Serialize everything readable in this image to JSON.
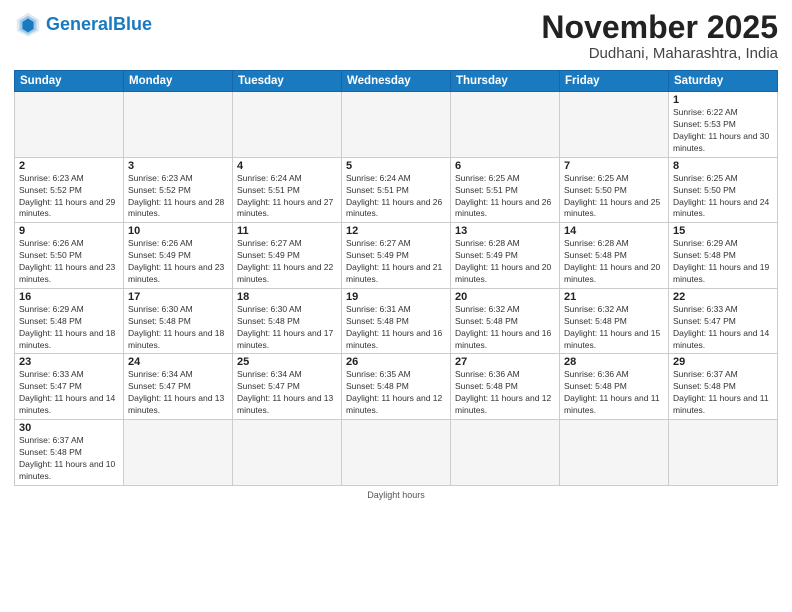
{
  "header": {
    "logo_general": "General",
    "logo_blue": "Blue",
    "month_title": "November 2025",
    "location": "Dudhani, Maharashtra, India"
  },
  "weekdays": [
    "Sunday",
    "Monday",
    "Tuesday",
    "Wednesday",
    "Thursday",
    "Friday",
    "Saturday"
  ],
  "footer": {
    "daylight_label": "Daylight hours"
  },
  "weeks": [
    [
      {
        "day": "",
        "sunrise": "",
        "sunset": "",
        "daylight": "",
        "empty": true
      },
      {
        "day": "",
        "sunrise": "",
        "sunset": "",
        "daylight": "",
        "empty": true
      },
      {
        "day": "",
        "sunrise": "",
        "sunset": "",
        "daylight": "",
        "empty": true
      },
      {
        "day": "",
        "sunrise": "",
        "sunset": "",
        "daylight": "",
        "empty": true
      },
      {
        "day": "",
        "sunrise": "",
        "sunset": "",
        "daylight": "",
        "empty": true
      },
      {
        "day": "",
        "sunrise": "",
        "sunset": "",
        "daylight": "",
        "empty": true
      },
      {
        "day": "1",
        "sunrise": "Sunrise: 6:22 AM",
        "sunset": "Sunset: 5:53 PM",
        "daylight": "Daylight: 11 hours and 30 minutes.",
        "empty": false
      }
    ],
    [
      {
        "day": "2",
        "sunrise": "Sunrise: 6:23 AM",
        "sunset": "Sunset: 5:52 PM",
        "daylight": "Daylight: 11 hours and 29 minutes.",
        "empty": false
      },
      {
        "day": "3",
        "sunrise": "Sunrise: 6:23 AM",
        "sunset": "Sunset: 5:52 PM",
        "daylight": "Daylight: 11 hours and 28 minutes.",
        "empty": false
      },
      {
        "day": "4",
        "sunrise": "Sunrise: 6:24 AM",
        "sunset": "Sunset: 5:51 PM",
        "daylight": "Daylight: 11 hours and 27 minutes.",
        "empty": false
      },
      {
        "day": "5",
        "sunrise": "Sunrise: 6:24 AM",
        "sunset": "Sunset: 5:51 PM",
        "daylight": "Daylight: 11 hours and 26 minutes.",
        "empty": false
      },
      {
        "day": "6",
        "sunrise": "Sunrise: 6:25 AM",
        "sunset": "Sunset: 5:51 PM",
        "daylight": "Daylight: 11 hours and 26 minutes.",
        "empty": false
      },
      {
        "day": "7",
        "sunrise": "Sunrise: 6:25 AM",
        "sunset": "Sunset: 5:50 PM",
        "daylight": "Daylight: 11 hours and 25 minutes.",
        "empty": false
      },
      {
        "day": "8",
        "sunrise": "Sunrise: 6:25 AM",
        "sunset": "Sunset: 5:50 PM",
        "daylight": "Daylight: 11 hours and 24 minutes.",
        "empty": false
      }
    ],
    [
      {
        "day": "9",
        "sunrise": "Sunrise: 6:26 AM",
        "sunset": "Sunset: 5:50 PM",
        "daylight": "Daylight: 11 hours and 23 minutes.",
        "empty": false
      },
      {
        "day": "10",
        "sunrise": "Sunrise: 6:26 AM",
        "sunset": "Sunset: 5:49 PM",
        "daylight": "Daylight: 11 hours and 23 minutes.",
        "empty": false
      },
      {
        "day": "11",
        "sunrise": "Sunrise: 6:27 AM",
        "sunset": "Sunset: 5:49 PM",
        "daylight": "Daylight: 11 hours and 22 minutes.",
        "empty": false
      },
      {
        "day": "12",
        "sunrise": "Sunrise: 6:27 AM",
        "sunset": "Sunset: 5:49 PM",
        "daylight": "Daylight: 11 hours and 21 minutes.",
        "empty": false
      },
      {
        "day": "13",
        "sunrise": "Sunrise: 6:28 AM",
        "sunset": "Sunset: 5:49 PM",
        "daylight": "Daylight: 11 hours and 20 minutes.",
        "empty": false
      },
      {
        "day": "14",
        "sunrise": "Sunrise: 6:28 AM",
        "sunset": "Sunset: 5:48 PM",
        "daylight": "Daylight: 11 hours and 20 minutes.",
        "empty": false
      },
      {
        "day": "15",
        "sunrise": "Sunrise: 6:29 AM",
        "sunset": "Sunset: 5:48 PM",
        "daylight": "Daylight: 11 hours and 19 minutes.",
        "empty": false
      }
    ],
    [
      {
        "day": "16",
        "sunrise": "Sunrise: 6:29 AM",
        "sunset": "Sunset: 5:48 PM",
        "daylight": "Daylight: 11 hours and 18 minutes.",
        "empty": false
      },
      {
        "day": "17",
        "sunrise": "Sunrise: 6:30 AM",
        "sunset": "Sunset: 5:48 PM",
        "daylight": "Daylight: 11 hours and 18 minutes.",
        "empty": false
      },
      {
        "day": "18",
        "sunrise": "Sunrise: 6:30 AM",
        "sunset": "Sunset: 5:48 PM",
        "daylight": "Daylight: 11 hours and 17 minutes.",
        "empty": false
      },
      {
        "day": "19",
        "sunrise": "Sunrise: 6:31 AM",
        "sunset": "Sunset: 5:48 PM",
        "daylight": "Daylight: 11 hours and 16 minutes.",
        "empty": false
      },
      {
        "day": "20",
        "sunrise": "Sunrise: 6:32 AM",
        "sunset": "Sunset: 5:48 PM",
        "daylight": "Daylight: 11 hours and 16 minutes.",
        "empty": false
      },
      {
        "day": "21",
        "sunrise": "Sunrise: 6:32 AM",
        "sunset": "Sunset: 5:48 PM",
        "daylight": "Daylight: 11 hours and 15 minutes.",
        "empty": false
      },
      {
        "day": "22",
        "sunrise": "Sunrise: 6:33 AM",
        "sunset": "Sunset: 5:47 PM",
        "daylight": "Daylight: 11 hours and 14 minutes.",
        "empty": false
      }
    ],
    [
      {
        "day": "23",
        "sunrise": "Sunrise: 6:33 AM",
        "sunset": "Sunset: 5:47 PM",
        "daylight": "Daylight: 11 hours and 14 minutes.",
        "empty": false
      },
      {
        "day": "24",
        "sunrise": "Sunrise: 6:34 AM",
        "sunset": "Sunset: 5:47 PM",
        "daylight": "Daylight: 11 hours and 13 minutes.",
        "empty": false
      },
      {
        "day": "25",
        "sunrise": "Sunrise: 6:34 AM",
        "sunset": "Sunset: 5:47 PM",
        "daylight": "Daylight: 11 hours and 13 minutes.",
        "empty": false
      },
      {
        "day": "26",
        "sunrise": "Sunrise: 6:35 AM",
        "sunset": "Sunset: 5:48 PM",
        "daylight": "Daylight: 11 hours and 12 minutes.",
        "empty": false
      },
      {
        "day": "27",
        "sunrise": "Sunrise: 6:36 AM",
        "sunset": "Sunset: 5:48 PM",
        "daylight": "Daylight: 11 hours and 12 minutes.",
        "empty": false
      },
      {
        "day": "28",
        "sunrise": "Sunrise: 6:36 AM",
        "sunset": "Sunset: 5:48 PM",
        "daylight": "Daylight: 11 hours and 11 minutes.",
        "empty": false
      },
      {
        "day": "29",
        "sunrise": "Sunrise: 6:37 AM",
        "sunset": "Sunset: 5:48 PM",
        "daylight": "Daylight: 11 hours and 11 minutes.",
        "empty": false
      }
    ],
    [
      {
        "day": "30",
        "sunrise": "Sunrise: 6:37 AM",
        "sunset": "Sunset: 5:48 PM",
        "daylight": "Daylight: 11 hours and 10 minutes.",
        "empty": false
      },
      {
        "day": "",
        "sunrise": "",
        "sunset": "",
        "daylight": "",
        "empty": true
      },
      {
        "day": "",
        "sunrise": "",
        "sunset": "",
        "daylight": "",
        "empty": true
      },
      {
        "day": "",
        "sunrise": "",
        "sunset": "",
        "daylight": "",
        "empty": true
      },
      {
        "day": "",
        "sunrise": "",
        "sunset": "",
        "daylight": "",
        "empty": true
      },
      {
        "day": "",
        "sunrise": "",
        "sunset": "",
        "daylight": "",
        "empty": true
      },
      {
        "day": "",
        "sunrise": "",
        "sunset": "",
        "daylight": "",
        "empty": true
      }
    ]
  ]
}
